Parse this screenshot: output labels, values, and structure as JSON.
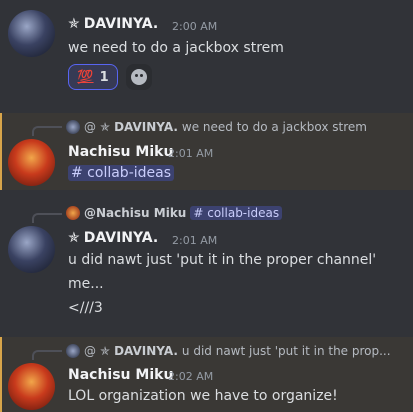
{
  "messages": [
    {
      "author": "DAVINYA.",
      "time": "2:00 AM",
      "lines": [
        "we need to do a jackbox strem"
      ],
      "reaction": {
        "emoji": "💯",
        "count": "1"
      }
    },
    {
      "author": "Nachisu Miku",
      "time": "2:01 AM",
      "reply_prefix": "@",
      "reply_author": "DAVINYA.",
      "reply_text": "we need to do a jackbox strem",
      "channel": "# collab-ideas"
    },
    {
      "author": "DAVINYA.",
      "time": "2:01 AM",
      "reply_author": "@Nachisu Miku",
      "reply_channel": "# collab-ideas",
      "lines": [
        "u did nawt just 'put it in the proper channel'",
        "me...",
        "<///3"
      ]
    },
    {
      "author": "Nachisu Miku",
      "time": "2:02 AM",
      "reply_prefix": "@",
      "reply_author": "DAVINYA.",
      "reply_text": "u did nawt just 'put it in the prop...",
      "lines": [
        "LOL organization we have to organize!"
      ]
    }
  ],
  "colors": {
    "background": "#313338",
    "highlight": "#3a3835",
    "mention_bg": "#3c4270",
    "accent": "#5865f2"
  }
}
